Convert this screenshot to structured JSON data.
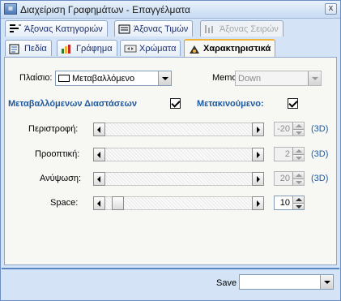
{
  "window": {
    "title": "Διαχείριση Γραφημάτων - Επαγγέλματα",
    "close": "x"
  },
  "tabs_row1": [
    {
      "label": "Άξονας Κατηγοριών",
      "icon": "category-axis-icon",
      "enabled": true
    },
    {
      "label": "Άξονας Τιμών",
      "icon": "value-axis-icon",
      "enabled": true
    },
    {
      "label": "Άξονας Σειρών",
      "icon": "series-axis-icon",
      "enabled": false
    }
  ],
  "tabs_row2": [
    {
      "label": "Πεδία",
      "icon": "fields-icon"
    },
    {
      "label": "Γράφημα",
      "icon": "chart-icon"
    },
    {
      "label": "Χρώματα",
      "icon": "colors-icon"
    },
    {
      "label": "Χαρακτηριστικά",
      "icon": "characteristics-icon",
      "active": true
    }
  ],
  "frame": {
    "label": "Πλαίσιο:",
    "value": "Μεταβαλλόμενο"
  },
  "memo": {
    "label": "Memo",
    "value": "Down"
  },
  "variable_dimensions": {
    "label": "Μεταβαλλόμενων Διαστάσεων",
    "checked": true
  },
  "movable": {
    "label": "Μετακινούμενο:",
    "checked": true
  },
  "sliders": [
    {
      "label": "Περιστροφή:",
      "value": "-20",
      "suffix": "(3D)",
      "enabled": false,
      "position": 0
    },
    {
      "label": "Προοπτική:",
      "value": "2",
      "suffix": "(3D)",
      "enabled": false,
      "position": 0
    },
    {
      "label": "Ανύψωση:",
      "value": "20",
      "suffix": "(3D)",
      "enabled": false,
      "position": 0
    },
    {
      "label": "Space:",
      "value": "10",
      "suffix": "",
      "enabled": true,
      "position": 0.05
    }
  ],
  "save": {
    "label": "Save",
    "value": ""
  }
}
